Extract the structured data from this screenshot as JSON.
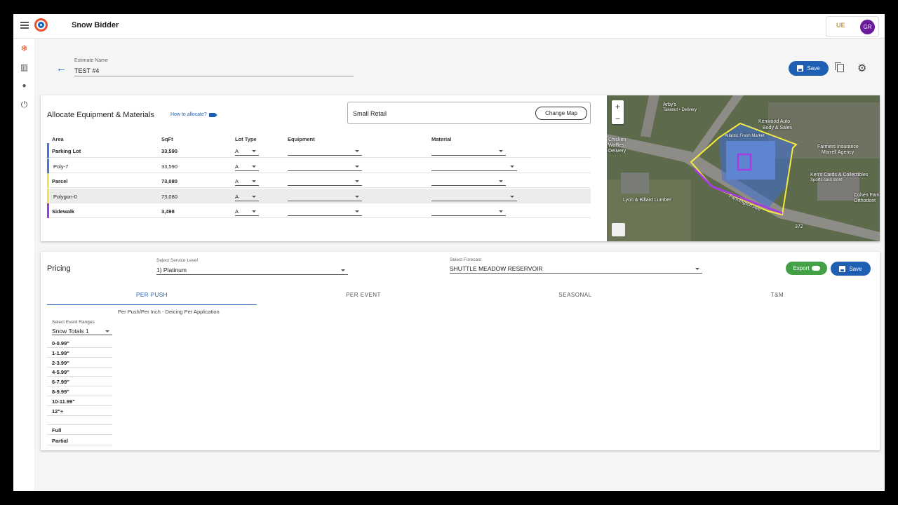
{
  "app": {
    "title": "Snow Bidder",
    "user_initials": "GR",
    "user_logo_text": "UE"
  },
  "nav": [
    {
      "name": "snowflake-icon",
      "glyph": "❄",
      "active": true
    },
    {
      "name": "map-icon",
      "glyph": "▥"
    },
    {
      "name": "user-icon",
      "glyph": "👤"
    },
    {
      "name": "power-icon",
      "glyph": "⏻"
    }
  ],
  "estimate": {
    "label": "Estimate Name",
    "value": "TEST #4"
  },
  "actions": {
    "save_label": "Save",
    "export_label": "Export"
  },
  "allocate": {
    "title": "Allocate Equipment & Materials",
    "how_to": "How to allocate?",
    "property": "Small Retail",
    "change_map": "Change Map",
    "columns": {
      "area": "Area",
      "sqft": "SqFt",
      "lot_type": "Lot Type",
      "equipment": "Equipment",
      "material": "Material"
    },
    "rows": [
      {
        "area": "Parking Lot",
        "sqft": "33,590",
        "lot_type": "A",
        "bold": true,
        "color": "#4a78d0"
      },
      {
        "area": "Poly-7",
        "sqft": "33,590",
        "lot_type": "A",
        "bold": false,
        "color": "#4a78d0"
      },
      {
        "area": "Parcel",
        "sqft": "73,080",
        "lot_type": "A",
        "bold": true,
        "color": "#f0e84a"
      },
      {
        "area": "Polygon-0",
        "sqft": "73,080",
        "lot_type": "A",
        "bold": false,
        "color": "#f0e84a",
        "highlight": true
      },
      {
        "area": "Sidewalk",
        "sqft": "3,498",
        "lot_type": "A",
        "bold": true,
        "color": "#9b3fd6"
      }
    ]
  },
  "map": {
    "labels": [
      "Arby's",
      "Takeout • Delivery",
      "Kenwood Auto",
      "Body & Sales",
      "Atlantic Fresh Market",
      "Farmers Insurance",
      "Morrell Agency",
      "Ken's Cards & Collectibles",
      "Sports card store",
      "Lyon & Billard Lumber",
      "Farmington Ave",
      "Cohen Fam",
      "Orthodont",
      "Chicken",
      "Waffles",
      "Delivery",
      "372"
    ],
    "colors": {
      "parcel": "#f5ec3a",
      "lot": "#3d6fd8",
      "sidewalk": "#a63de0"
    }
  },
  "pricing": {
    "title": "Pricing",
    "service_level_label": "Select Service Level",
    "service_level": "1) Platinum",
    "forecast_label": "Select Forecast",
    "forecast": "SHUTTLE MEADOW RESERVOIR",
    "tabs": [
      "PER PUSH",
      "PER EVENT",
      "SEASONAL",
      "T&M"
    ],
    "active_tab": "PER PUSH",
    "subtitle": "Per Push/Per Inch - Deicing Per Application",
    "event_ranges_label": "Select Event Ranges",
    "event_ranges": "Snow Totals 1",
    "ranges": [
      "0-0.99\"",
      "1-1.99\"",
      "2-3.99\"",
      "4-5.99\"",
      "6-7.99\"",
      "8-9.99\"",
      "10-11.99\"",
      "12\"+"
    ],
    "extras": [
      "Full",
      "Partial"
    ]
  }
}
